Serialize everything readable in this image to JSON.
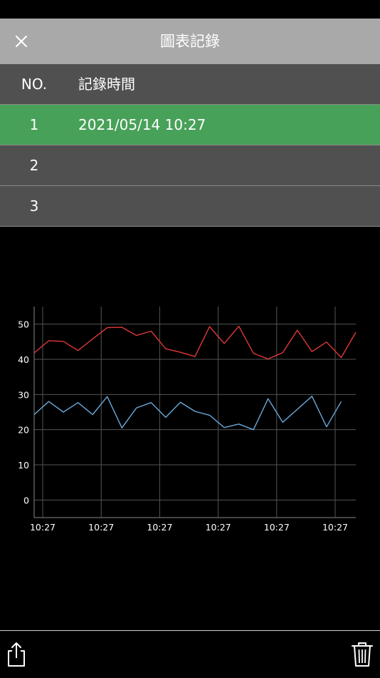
{
  "header": {
    "title": "圖表記錄",
    "close_icon": "close-icon"
  },
  "table": {
    "columns": [
      "NO.",
      "記錄時間"
    ],
    "rows": [
      {
        "no": "1",
        "time": "2021/05/14 10:27",
        "selected": true
      },
      {
        "no": "2",
        "time": ""
      },
      {
        "no": "3",
        "time": ""
      }
    ]
  },
  "colors": {
    "header_bg": "#a9a9a9",
    "row_bg": "#505050",
    "selected_row_bg": "#47a158",
    "series_red": "#e0393b",
    "series_blue": "#6aa9da"
  },
  "chart_data": {
    "type": "line",
    "ylim": [
      -5,
      55
    ],
    "yticks": [
      0,
      10,
      20,
      30,
      40,
      50
    ],
    "xtick_labels": [
      "10:27",
      "10:27",
      "10:27",
      "10:27",
      "10:27",
      "10:27"
    ],
    "grid": true,
    "series": [
      {
        "color": "#e0393b",
        "values": [
          41.8,
          45.3,
          45.1,
          42.5,
          45.8,
          49.0,
          49.1,
          46.8,
          48.0,
          43.0,
          42.0,
          40.8,
          49.3,
          44.5,
          49.4,
          41.7,
          40.1,
          41.9,
          48.3,
          42.2,
          44.9,
          40.5,
          47.7
        ]
      },
      {
        "color": "#6aa9da",
        "values": [
          24.3,
          28.0,
          25.0,
          27.7,
          24.3,
          29.4,
          20.5,
          26.2,
          27.7,
          23.5,
          27.8,
          25.2,
          24.1,
          20.6,
          21.6,
          20.0,
          28.8,
          22.1,
          25.8,
          29.5,
          20.8,
          28.0
        ]
      }
    ]
  },
  "toolbar": {
    "share_icon": "share-icon",
    "trash_icon": "trash-icon"
  }
}
